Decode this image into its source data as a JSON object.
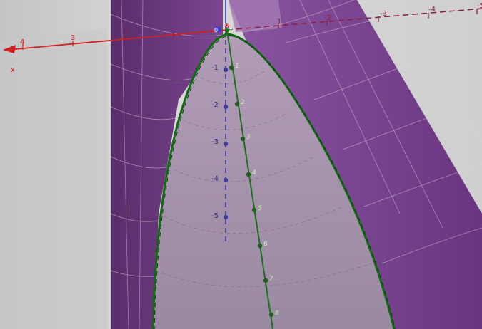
{
  "view": {
    "colors": {
      "background_left": "#b8b8b8",
      "background_right": "#d2d2d2",
      "surface": "#6f3a83",
      "surface_dark": "#4a2358",
      "surface_light": "#9a6aa9",
      "interior": "#9a879f",
      "curve": "#0f6a12",
      "curve_points": "#1f5e1f",
      "x_axis": "#d01f1f",
      "z_axis": "#3a3ad0",
      "dashed_axis": "#3e3e9a",
      "marker_red": "#e02020"
    },
    "x_axis": {
      "label": "x",
      "tick_labels_front": [
        "4",
        "3",
        "2"
      ],
      "tick_labels_back": [
        "1",
        "-2",
        "-3",
        "-4",
        "-5"
      ]
    },
    "vertical_axis": {
      "tick_labels": [
        "-1",
        "-2",
        "-3",
        "-4",
        "-5"
      ]
    },
    "origin_labels": [
      "0",
      "0",
      "0"
    ],
    "curve_point_labels": [
      "1",
      "2",
      "3",
      "4",
      "5",
      "6",
      "7",
      "8"
    ]
  }
}
